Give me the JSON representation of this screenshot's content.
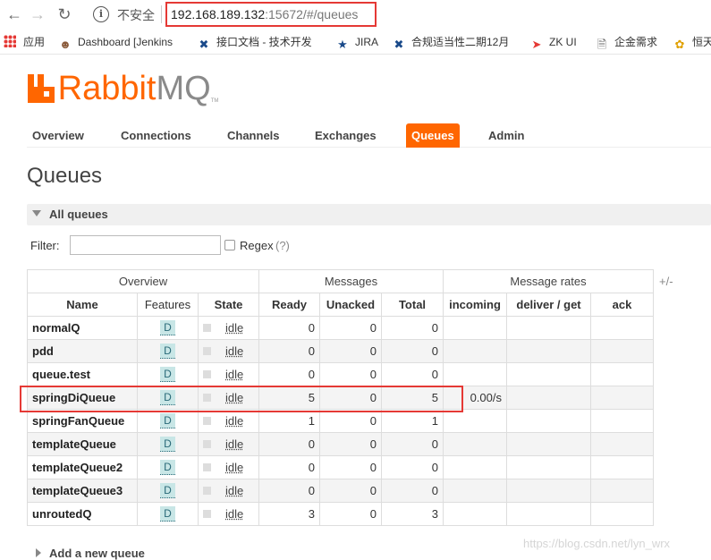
{
  "browser": {
    "security_text": "不安全",
    "url_host": "192.168.189.132",
    "url_rest": ":15672/#/queues",
    "bookmarks": [
      {
        "label": "应用",
        "icon": "apps-grid-icon"
      },
      {
        "label": "Dashboard [Jenkins",
        "icon": "jenkins-icon"
      },
      {
        "label": "接口文档 - 技术开发",
        "icon": "wrench-cross-icon"
      },
      {
        "label": "JIRA",
        "icon": "jira-icon"
      },
      {
        "label": "合规适当性二期12月",
        "icon": "wrench-cross-icon"
      },
      {
        "label": "ZK UI",
        "icon": "red-arrow-icon"
      },
      {
        "label": "企金需求",
        "icon": "document-icon"
      },
      {
        "label": "恒天",
        "icon": "hengtian-icon"
      }
    ]
  },
  "brand": {
    "rabbit": "Rabbit",
    "mq": "MQ",
    "tm": "TM"
  },
  "tabs": [
    {
      "label": "Overview",
      "active": false
    },
    {
      "label": "Connections",
      "active": false
    },
    {
      "label": "Channels",
      "active": false
    },
    {
      "label": "Exchanges",
      "active": false
    },
    {
      "label": "Queues",
      "active": true
    },
    {
      "label": "Admin",
      "active": false
    }
  ],
  "page_title": "Queues",
  "section": {
    "label": "All queues"
  },
  "filter": {
    "label": "Filter:",
    "value": "",
    "regex_label": "Regex",
    "regex_help": "(?)"
  },
  "table": {
    "group_headers": [
      "Overview",
      "Messages",
      "Message rates"
    ],
    "columns": [
      "Name",
      "Features",
      "State",
      "Ready",
      "Unacked",
      "Total",
      "incoming",
      "deliver / get",
      "ack"
    ],
    "toggle": "+/-",
    "rows": [
      {
        "name": "normalQ",
        "feature": "D",
        "state": "idle",
        "ready": "0",
        "unacked": "0",
        "total": "0",
        "incoming": "",
        "deliver_get": "",
        "ack": ""
      },
      {
        "name": "pdd",
        "feature": "D",
        "state": "idle",
        "ready": "0",
        "unacked": "0",
        "total": "0",
        "incoming": "",
        "deliver_get": "",
        "ack": ""
      },
      {
        "name": "queue.test",
        "feature": "D",
        "state": "idle",
        "ready": "0",
        "unacked": "0",
        "total": "0",
        "incoming": "",
        "deliver_get": "",
        "ack": ""
      },
      {
        "name": "springDiQueue",
        "feature": "D",
        "state": "idle",
        "ready": "5",
        "unacked": "0",
        "total": "5",
        "incoming": "0.00/s",
        "deliver_get": "",
        "ack": ""
      },
      {
        "name": "springFanQueue",
        "feature": "D",
        "state": "idle",
        "ready": "1",
        "unacked": "0",
        "total": "1",
        "incoming": "",
        "deliver_get": "",
        "ack": ""
      },
      {
        "name": "templateQueue",
        "feature": "D",
        "state": "idle",
        "ready": "0",
        "unacked": "0",
        "total": "0",
        "incoming": "",
        "deliver_get": "",
        "ack": ""
      },
      {
        "name": "templateQueue2",
        "feature": "D",
        "state": "idle",
        "ready": "0",
        "unacked": "0",
        "total": "0",
        "incoming": "",
        "deliver_get": "",
        "ack": ""
      },
      {
        "name": "templateQueue3",
        "feature": "D",
        "state": "idle",
        "ready": "0",
        "unacked": "0",
        "total": "0",
        "incoming": "",
        "deliver_get": "",
        "ack": ""
      },
      {
        "name": "unroutedQ",
        "feature": "D",
        "state": "idle",
        "ready": "3",
        "unacked": "0",
        "total": "3",
        "incoming": "",
        "deliver_get": "",
        "ack": ""
      }
    ]
  },
  "add_queue": {
    "label": "Add a new queue"
  },
  "watermark": "https://blog.csdn.net/lyn_wrx",
  "colors": {
    "brand_orange": "#ff6600",
    "highlight_red": "#e53935"
  }
}
